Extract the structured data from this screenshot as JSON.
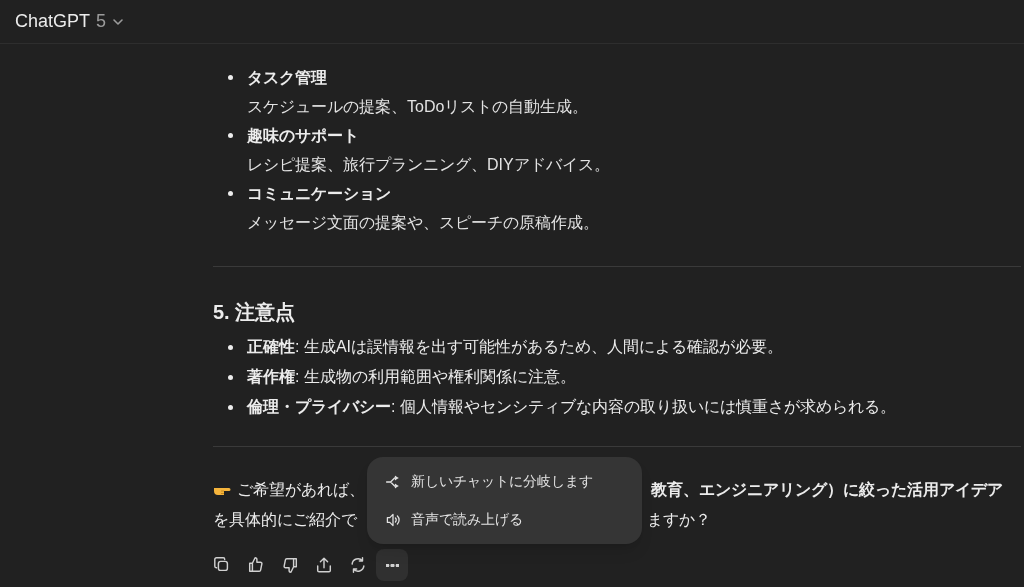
{
  "header": {
    "title": "ChatGPT",
    "version": "5"
  },
  "section4_items": [
    {
      "title": "タスク管理",
      "description": "スケジュールの提案、ToDoリストの自動生成。"
    },
    {
      "title": "趣味のサポート",
      "description": "レシピ提案、旅行プランニング、DIYアドバイス。"
    },
    {
      "title": "コミュニケーション",
      "description": "メッセージ文面の提案や、スピーチの原稿作成。"
    }
  ],
  "section5": {
    "heading": "5. 注意点",
    "items": [
      "**正確性**: 生成AIは誤情報を出す可能性があるため、人間による確認が必要。",
      "**著作権**: 生成物の利用範囲や権利関係に注意。",
      "**倫理・プライバシー**: 個人情報やセンシティブな内容の取り扱いには慎重さが求められる。"
    ]
  },
  "closing": {
    "line1_start": "ご希望があれば、",
    "line1_end": "**教育、エンジニアリング）に絞った活用アイデア**",
    "line2_start": "を具体的にご紹介で",
    "line2_end": "ますか？"
  },
  "actions": [
    {
      "kind": "copy"
    },
    {
      "kind": "like"
    },
    {
      "kind": "dislike"
    },
    {
      "kind": "share"
    },
    {
      "kind": "regenerate"
    },
    {
      "kind": "more",
      "selected": true
    }
  ],
  "menu": [
    {
      "kind": "branch",
      "label": "新しいチャットに分岐します"
    },
    {
      "kind": "speaker",
      "label": "音声で読み上げる"
    }
  ]
}
